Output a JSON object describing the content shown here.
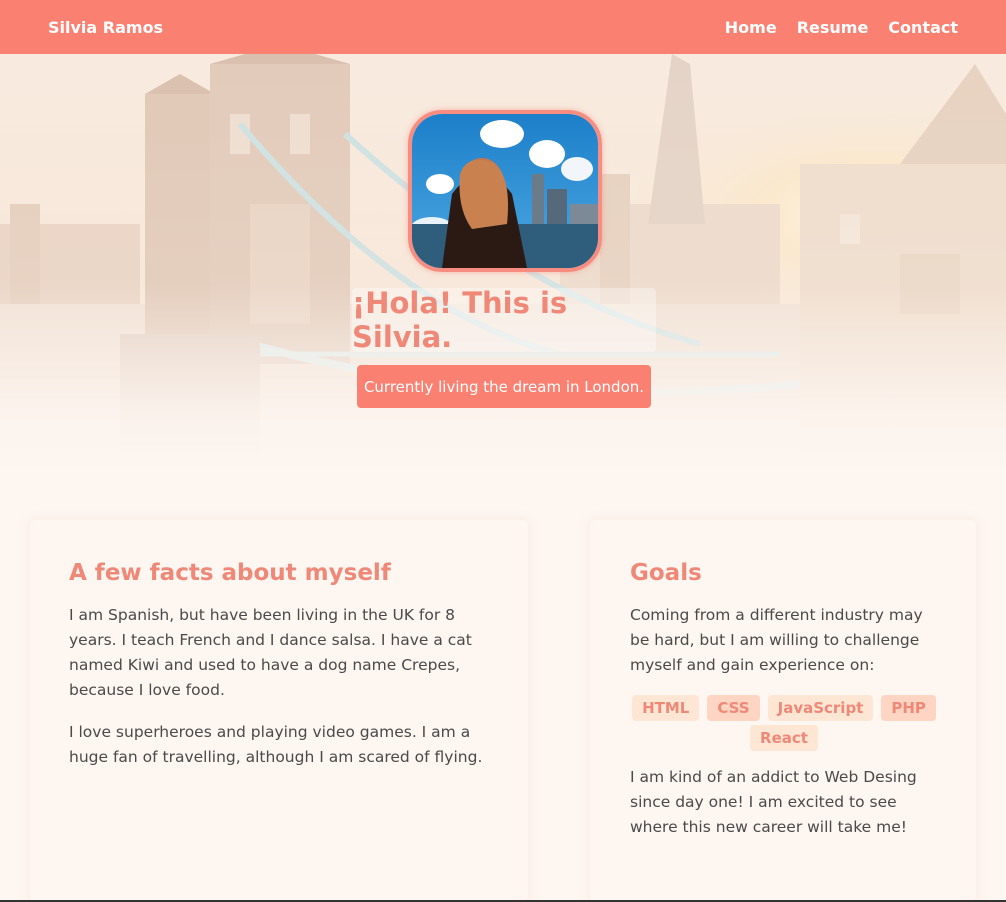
{
  "nav": {
    "brand": "Silvia Ramos",
    "links": [
      "Home",
      "Resume",
      "Contact"
    ]
  },
  "hero": {
    "title": "¡Hola! This is Silvia.",
    "subtitle": "Currently living the dream in London."
  },
  "facts": {
    "heading": "A few facts about myself",
    "paragraphs": [
      "I am Spanish, but have been living in the UK for 8 years. I teach French and I dance salsa. I have a cat named Kiwi and used to have a dog name Crepes, because I love food.",
      "I love superheroes and playing video games. I am a huge fan of travelling, although I am scared of flying."
    ]
  },
  "goals": {
    "heading": "Goals",
    "intro": "Coming from a different industry may be hard, but I am willing to challenge myself and gain experience on:",
    "tags": [
      "HTML",
      "CSS",
      "JavaScript",
      "PHP",
      "React"
    ],
    "outro": "I am kind of an addict to Web Desing since day one! I am excited to see where this new career will take me!"
  },
  "colors": {
    "accent": "#fa8072",
    "heading": "#f08878",
    "background": "#fdf6f1",
    "text": "#4a4a4a"
  }
}
